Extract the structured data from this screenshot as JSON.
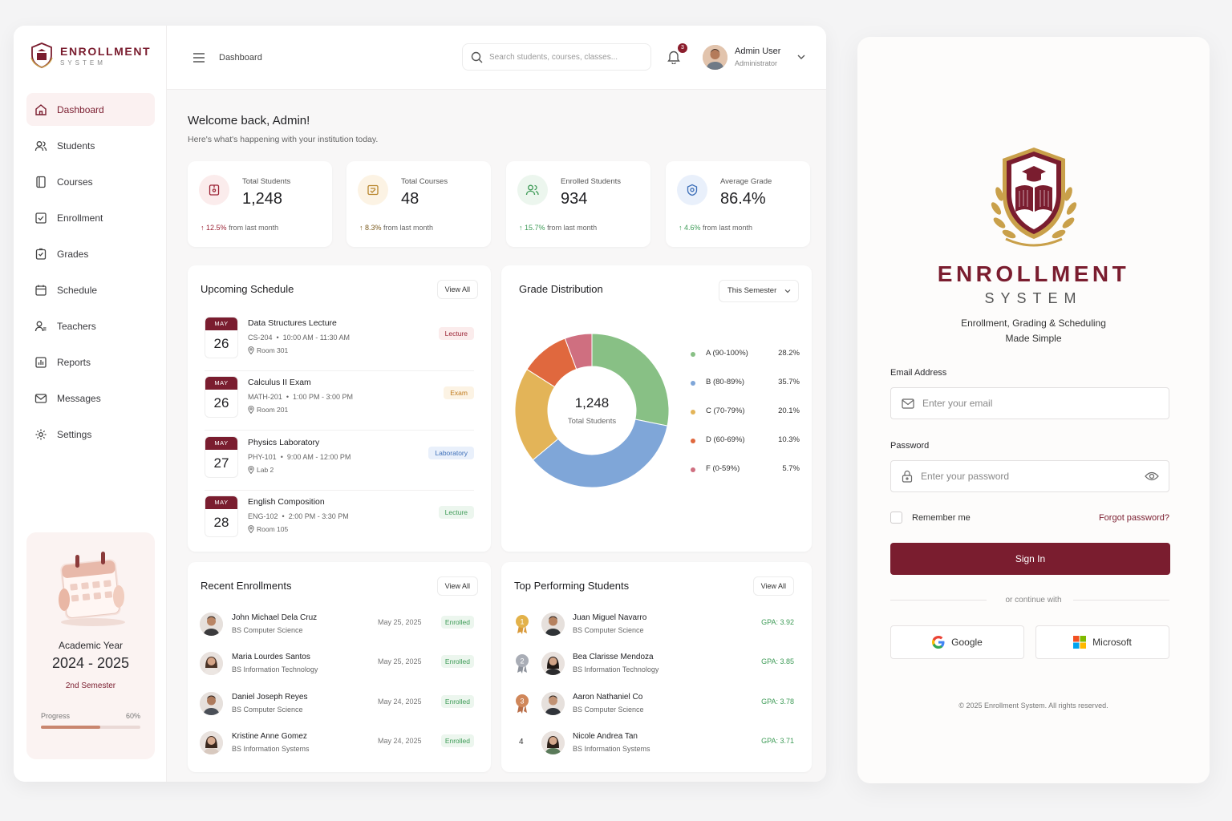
{
  "brand": {
    "name": "ENROLLMENT",
    "sub": "SYSTEM"
  },
  "nav": [
    {
      "label": "Dashboard",
      "icon": "home-icon",
      "active": true
    },
    {
      "label": "Students",
      "icon": "users-icon"
    },
    {
      "label": "Courses",
      "icon": "book-icon"
    },
    {
      "label": "Enrollment",
      "icon": "check-square-icon"
    },
    {
      "label": "Grades",
      "icon": "grade-icon"
    },
    {
      "label": "Schedule",
      "icon": "calendar-icon"
    },
    {
      "label": "Teachers",
      "icon": "teacher-icon"
    },
    {
      "label": "Reports",
      "icon": "chart-icon"
    },
    {
      "label": "Messages",
      "icon": "mail-icon"
    },
    {
      "label": "Settings",
      "icon": "gear-icon"
    }
  ],
  "academic": {
    "label": "Academic Year",
    "year": "2024 - 2025",
    "semester": "2nd Semester",
    "progress_label": "Progress",
    "progress_text": "60%",
    "progress": 0.6
  },
  "topbar": {
    "breadcrumb": "Dashboard",
    "search_placeholder": "Search students, courses, classes...",
    "notifications": "3",
    "user_name": "Admin User",
    "user_role": "Administrator"
  },
  "welcome": {
    "title": "Welcome back, Admin!",
    "subtitle": "Here's what's happening with your institution today."
  },
  "stats": [
    {
      "label": "Total Students",
      "value": "1,248",
      "trend": "12.5%",
      "trend_text": "from last month",
      "color": "#9b2335",
      "bg": "#fbecec"
    },
    {
      "label": "Total Courses",
      "value": "48",
      "trend": "8.3%",
      "trend_text": "from last month",
      "color": "#b8862d",
      "bg": "#fcf3e4"
    },
    {
      "label": "Enrolled Students",
      "value": "934",
      "trend": "15.7%",
      "trend_text": "from last month",
      "color": "#3e9b57",
      "bg": "#ecf6ee"
    },
    {
      "label": "Average Grade",
      "value": "86.4%",
      "trend": "4.6%",
      "trend_text": "from last month",
      "color": "#3d6fb8",
      "bg": "#e9f0fb"
    }
  ],
  "schedule": {
    "title": "Upcoming Schedule",
    "view_all": "View All",
    "items": [
      {
        "month": "MAY",
        "day": "26",
        "title": "Data Structures Lecture",
        "code": "CS-204",
        "time": "10:00 AM - 11:30 AM",
        "room": "Room 301",
        "tag": "Lecture",
        "tag_style": "pill-lecture-red"
      },
      {
        "month": "MAY",
        "day": "26",
        "title": "Calculus II Exam",
        "code": "MATH-201",
        "time": "1:00 PM - 3:00 PM",
        "room": "Room 201",
        "tag": "Exam",
        "tag_style": "pill-exam"
      },
      {
        "month": "MAY",
        "day": "27",
        "title": "Physics Laboratory",
        "code": "PHY-101",
        "time": "9:00 AM - 12:00 PM",
        "room": "Lab 2",
        "tag": "Laboratory",
        "tag_style": "pill-lab"
      },
      {
        "month": "MAY",
        "day": "28",
        "title": "English Composition",
        "code": "ENG-102",
        "time": "2:00 PM - 3:30 PM",
        "room": "Room 105",
        "tag": "Lecture",
        "tag_style": "pill-lecture-green"
      }
    ]
  },
  "grades": {
    "title": "Grade Distribution",
    "period": "This Semester",
    "center_value": "1,248",
    "center_label": "Total Students"
  },
  "chart_data": {
    "type": "pie",
    "categories": [
      "A (90-100%)",
      "B (80-89%)",
      "C (70-79%)",
      "D (60-69%)",
      "F (0-59%)"
    ],
    "values": [
      28.2,
      35.7,
      20.1,
      10.3,
      5.7
    ],
    "labels": [
      "28.2%",
      "35.7%",
      "20.1%",
      "10.3%",
      "5.7%"
    ],
    "colors": [
      "#88c085",
      "#7fa6d8",
      "#e3b458",
      "#e0683e",
      "#cf6f80"
    ],
    "donut": true,
    "legend": "right"
  },
  "enrollments": {
    "title": "Recent Enrollments",
    "view_all": "View All",
    "items": [
      {
        "name": "John Michael Dela Cruz",
        "program": "BS Computer Science",
        "date": "May 25, 2025",
        "status": "Enrolled"
      },
      {
        "name": "Maria Lourdes Santos",
        "program": "BS Information Technology",
        "date": "May 25, 2025",
        "status": "Enrolled"
      },
      {
        "name": "Daniel Joseph Reyes",
        "program": "BS Computer Science",
        "date": "May 24, 2025",
        "status": "Enrolled"
      },
      {
        "name": "Kristine Anne Gomez",
        "program": "BS Information Systems",
        "date": "May 24, 2025",
        "status": "Enrolled"
      }
    ]
  },
  "top": {
    "title": "Top Performing Students",
    "view_all": "View All",
    "items": [
      {
        "rank": "1",
        "name": "Juan Miguel Navarro",
        "program": "BS Computer Science",
        "gpa": "GPA: 3.92",
        "medal": "#e3b24a"
      },
      {
        "rank": "2",
        "name": "Bea Clarisse Mendoza",
        "program": "BS Information Technology",
        "gpa": "GPA: 3.85",
        "medal": "#a9adb6"
      },
      {
        "rank": "3",
        "name": "Aaron Nathaniel Co",
        "program": "BS Computer Science",
        "gpa": "GPA: 3.78",
        "medal": "#d0875a"
      },
      {
        "rank": "4",
        "name": "Nicole Andrea Tan",
        "program": "BS Information Systems",
        "gpa": "GPA: 3.71",
        "medal": ""
      }
    ]
  },
  "login": {
    "title": "ENROLLMENT",
    "sub": "SYSTEM",
    "tagline1": "Enrollment, Grading & Scheduling",
    "tagline2": "Made Simple",
    "email_label": "Email Address",
    "email_placeholder": "Enter your email",
    "password_label": "Password",
    "password_placeholder": "Enter your password",
    "remember": "Remember me",
    "forgot": "Forgot password?",
    "signin": "Sign In",
    "continue": "or continue with",
    "google": "Google",
    "microsoft": "Microsoft",
    "copyright": "© 2025 Enrollment System. All rights reserved."
  },
  "colors": {
    "brand": "#7a1d2f",
    "success": "#3e9b57",
    "gold": "#c9a04a"
  }
}
